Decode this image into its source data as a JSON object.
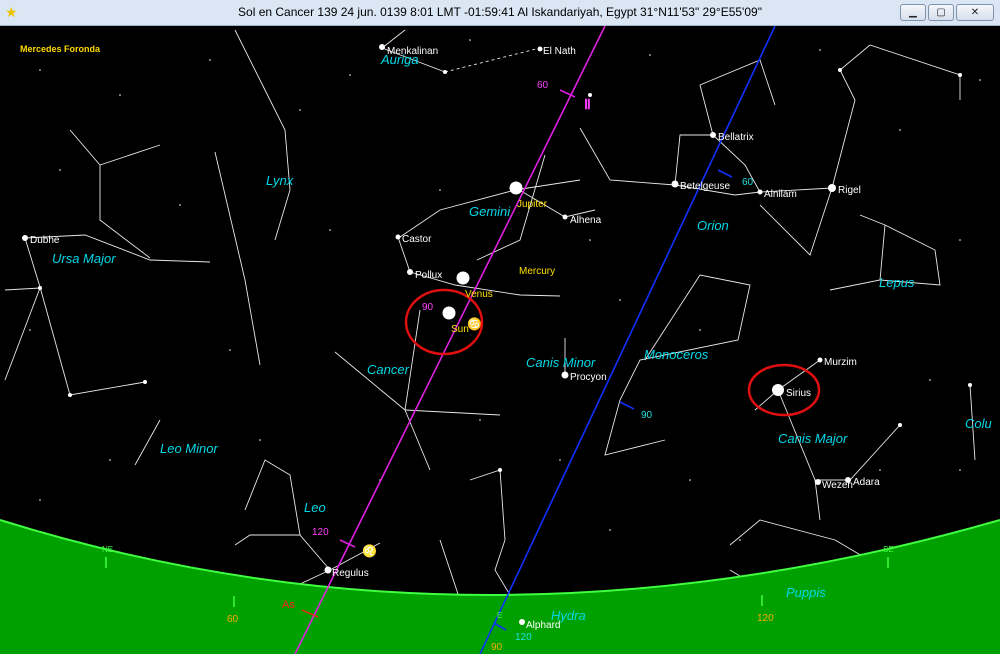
{
  "window": {
    "title": "Sol en Cancer 139  24 jun. 0139 8:01 LMT -01:59:41 Al Iskandariyah, Egypt 31°N11'53\" 29°E55'09\"",
    "app_icon": "star-icon",
    "minimize_icon": "minimize-icon",
    "maximize_icon": "maximize-icon",
    "close_icon": "close-icon"
  },
  "chart": {
    "owner": "Mercedes Foronda",
    "constellations": {
      "auriga": "Auriga",
      "lynx": "Lynx",
      "ursa_major": "Ursa Major",
      "gemini": "Gemini",
      "orion": "Orion",
      "lepus": "Lepus",
      "cancer": "Cancer",
      "canis_minor": "Canis Minor",
      "monoceros": "Monoceros",
      "leo_minor": "Leo Minor",
      "canis_major": "Canis Major",
      "columba": "Colu",
      "leo": "Leo",
      "hydra": "Hydra",
      "puppis": "Puppis"
    },
    "stars": {
      "menkalinan": "Menkalinan",
      "el_nath": "El Nath",
      "bellatrix": "Bellatrix",
      "betelgeuse": "Betelgeuse",
      "alnilam": "Alnilam",
      "rigel": "Rigel",
      "dubhe": "Dubhe",
      "alhena": "Alhena",
      "castor": "Castor",
      "pollux": "Pollux",
      "procyon": "Procyon",
      "murzim": "Murzim",
      "sirius": "Sirius",
      "wezen": "Wezen",
      "adara": "Adara",
      "regulus": "Regulus",
      "alphard": "Alphard"
    },
    "planets": {
      "jupiter": "Jupiter",
      "mercury": "Mercury",
      "venus": "Venus",
      "sun": "Sun"
    },
    "ecliptic_ticks": {
      "t60": "60",
      "t90": "90",
      "t120": "120"
    },
    "equator_ticks": {
      "t60": "60",
      "t90": "90",
      "t120": "120"
    },
    "horizon": {
      "ne": "NE",
      "se": "SE",
      "e": "E",
      "as": "As",
      "t60": "60",
      "t90": "90",
      "t120": "120"
    },
    "signs": {
      "gemini": "Ⅱ",
      "cancer": "♋",
      "leo": "♌"
    },
    "colors": {
      "ecliptic": "#e020e0",
      "equator": "#1030ff",
      "horizon": "#10d010",
      "highlight": "#e01010",
      "constellation": "#00e0e0",
      "planet": "#ffe000"
    }
  }
}
